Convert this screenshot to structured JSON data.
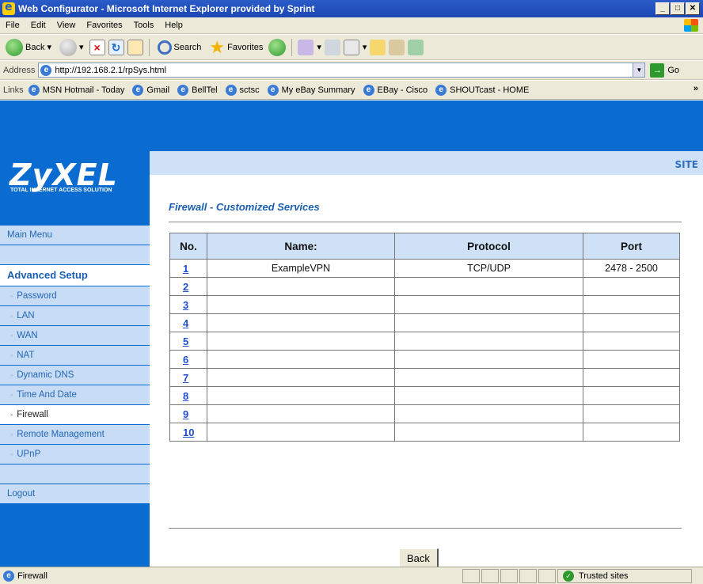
{
  "window": {
    "title": "Web Configurator - Microsoft Internet Explorer provided by Sprint"
  },
  "menu": [
    "File",
    "Edit",
    "View",
    "Favorites",
    "Tools",
    "Help"
  ],
  "toolbar": {
    "back": "Back",
    "search": "Search",
    "favorites": "Favorites"
  },
  "address": {
    "label": "Address",
    "url": "http://192.168.2.1/rpSys.html",
    "go": "Go"
  },
  "links": {
    "label": "Links",
    "items": [
      "MSN Hotmail - Today",
      "Gmail",
      "BellTel",
      "sctsc",
      "My eBay Summary",
      "EBay - Cisco",
      "SHOUTcast - HOME"
    ]
  },
  "brand": {
    "name": "ZyXEL",
    "tagline": "TOTAL INTERNET ACCESS SOLUTION",
    "site_label": "SITE"
  },
  "nav": {
    "main_menu": "Main Menu",
    "advanced_setup": "Advanced Setup",
    "items": [
      "Password",
      "LAN",
      "WAN",
      "NAT",
      "Dynamic DNS",
      "Time And Date",
      "Firewall",
      "Remote Management",
      "UPnP"
    ],
    "active": "Firewall",
    "logout": "Logout"
  },
  "page": {
    "heading": "Firewall - Customized Services"
  },
  "table": {
    "headers": [
      "No.",
      "Name:",
      "Protocol",
      "Port"
    ],
    "rows": [
      {
        "no": "1",
        "name": "ExampleVPN",
        "protocol": "TCP/UDP",
        "port": "2478 - 2500"
      },
      {
        "no": "2",
        "name": "",
        "protocol": "",
        "port": ""
      },
      {
        "no": "3",
        "name": "",
        "protocol": "",
        "port": ""
      },
      {
        "no": "4",
        "name": "",
        "protocol": "",
        "port": ""
      },
      {
        "no": "5",
        "name": "",
        "protocol": "",
        "port": ""
      },
      {
        "no": "6",
        "name": "",
        "protocol": "",
        "port": ""
      },
      {
        "no": "7",
        "name": "",
        "protocol": "",
        "port": ""
      },
      {
        "no": "8",
        "name": "",
        "protocol": "",
        "port": ""
      },
      {
        "no": "9",
        "name": "",
        "protocol": "",
        "port": ""
      },
      {
        "no": "10",
        "name": "",
        "protocol": "",
        "port": ""
      }
    ]
  },
  "buttons": {
    "back": "Back"
  },
  "status": {
    "text": "Firewall",
    "zone": "Trusted sites"
  }
}
